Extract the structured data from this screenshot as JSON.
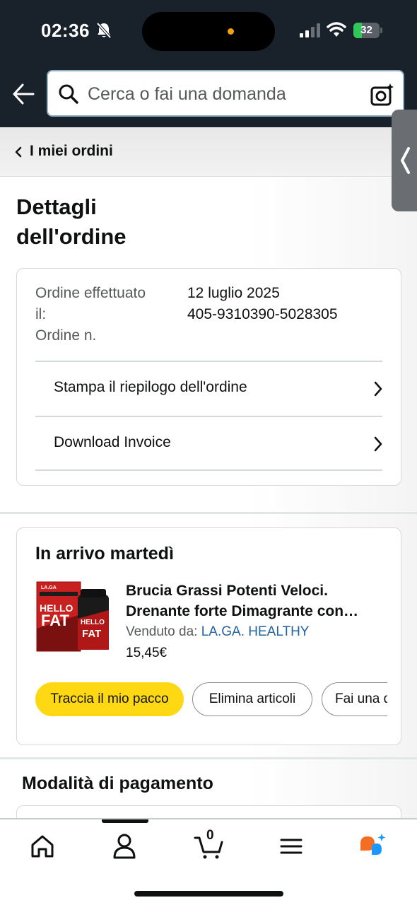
{
  "status_bar": {
    "time": "02:36",
    "battery": "32",
    "battery_level_percent": 32,
    "icons": [
      "bell-slash-icon",
      "signal-icon",
      "wifi-icon",
      "battery-icon"
    ]
  },
  "header": {
    "search_placeholder": "Cerca o fai una domanda",
    "icons": [
      "back-arrow-icon",
      "search-icon",
      "camera-icon"
    ]
  },
  "breadcrumb": {
    "label": "I miei ordini"
  },
  "page": {
    "title_line1": "Dettagli",
    "title_line2": "dell'ordine"
  },
  "order_info": {
    "placed_label_line1": "Ordine effettuato",
    "placed_label_line2": "il:",
    "number_label": "Ordine n.",
    "placed_value": "12 luglio 2025",
    "number_value": "405-9310390-5028305",
    "links": [
      {
        "label": "Stampa il riepilogo dell'ordine"
      },
      {
        "label": "Download Invoice"
      }
    ]
  },
  "shipment": {
    "title": "In arrivo martedì",
    "product": {
      "title_line1": "Brucia Grassi Potenti Veloci.",
      "title_line2": "Drenante forte Dimagrante con…",
      "sold_by_label": "Venduto da: ",
      "seller": "LA.GA. HEALTHY",
      "price": "15,45€",
      "image_text_brand": "LA.GA",
      "image_text_line1": "HELLO",
      "image_text_line2": "FAT"
    },
    "actions": [
      {
        "label": "Traccia il mio pacco",
        "primary": true
      },
      {
        "label": "Elimina articoli",
        "primary": false
      },
      {
        "label": "Fai una d",
        "primary": false
      }
    ]
  },
  "payment": {
    "title": "Modalità di pagamento"
  },
  "tabbar": {
    "cart_count": "0",
    "items": [
      "home-icon",
      "account-icon",
      "cart-icon",
      "menu-icon",
      "rufus-assistant-icon"
    ]
  },
  "colors": {
    "header_bg": "#19212b",
    "primary_button": "#ffd814",
    "link": "#2162a1",
    "text": "#0f1111",
    "secondary_text": "#565959"
  }
}
